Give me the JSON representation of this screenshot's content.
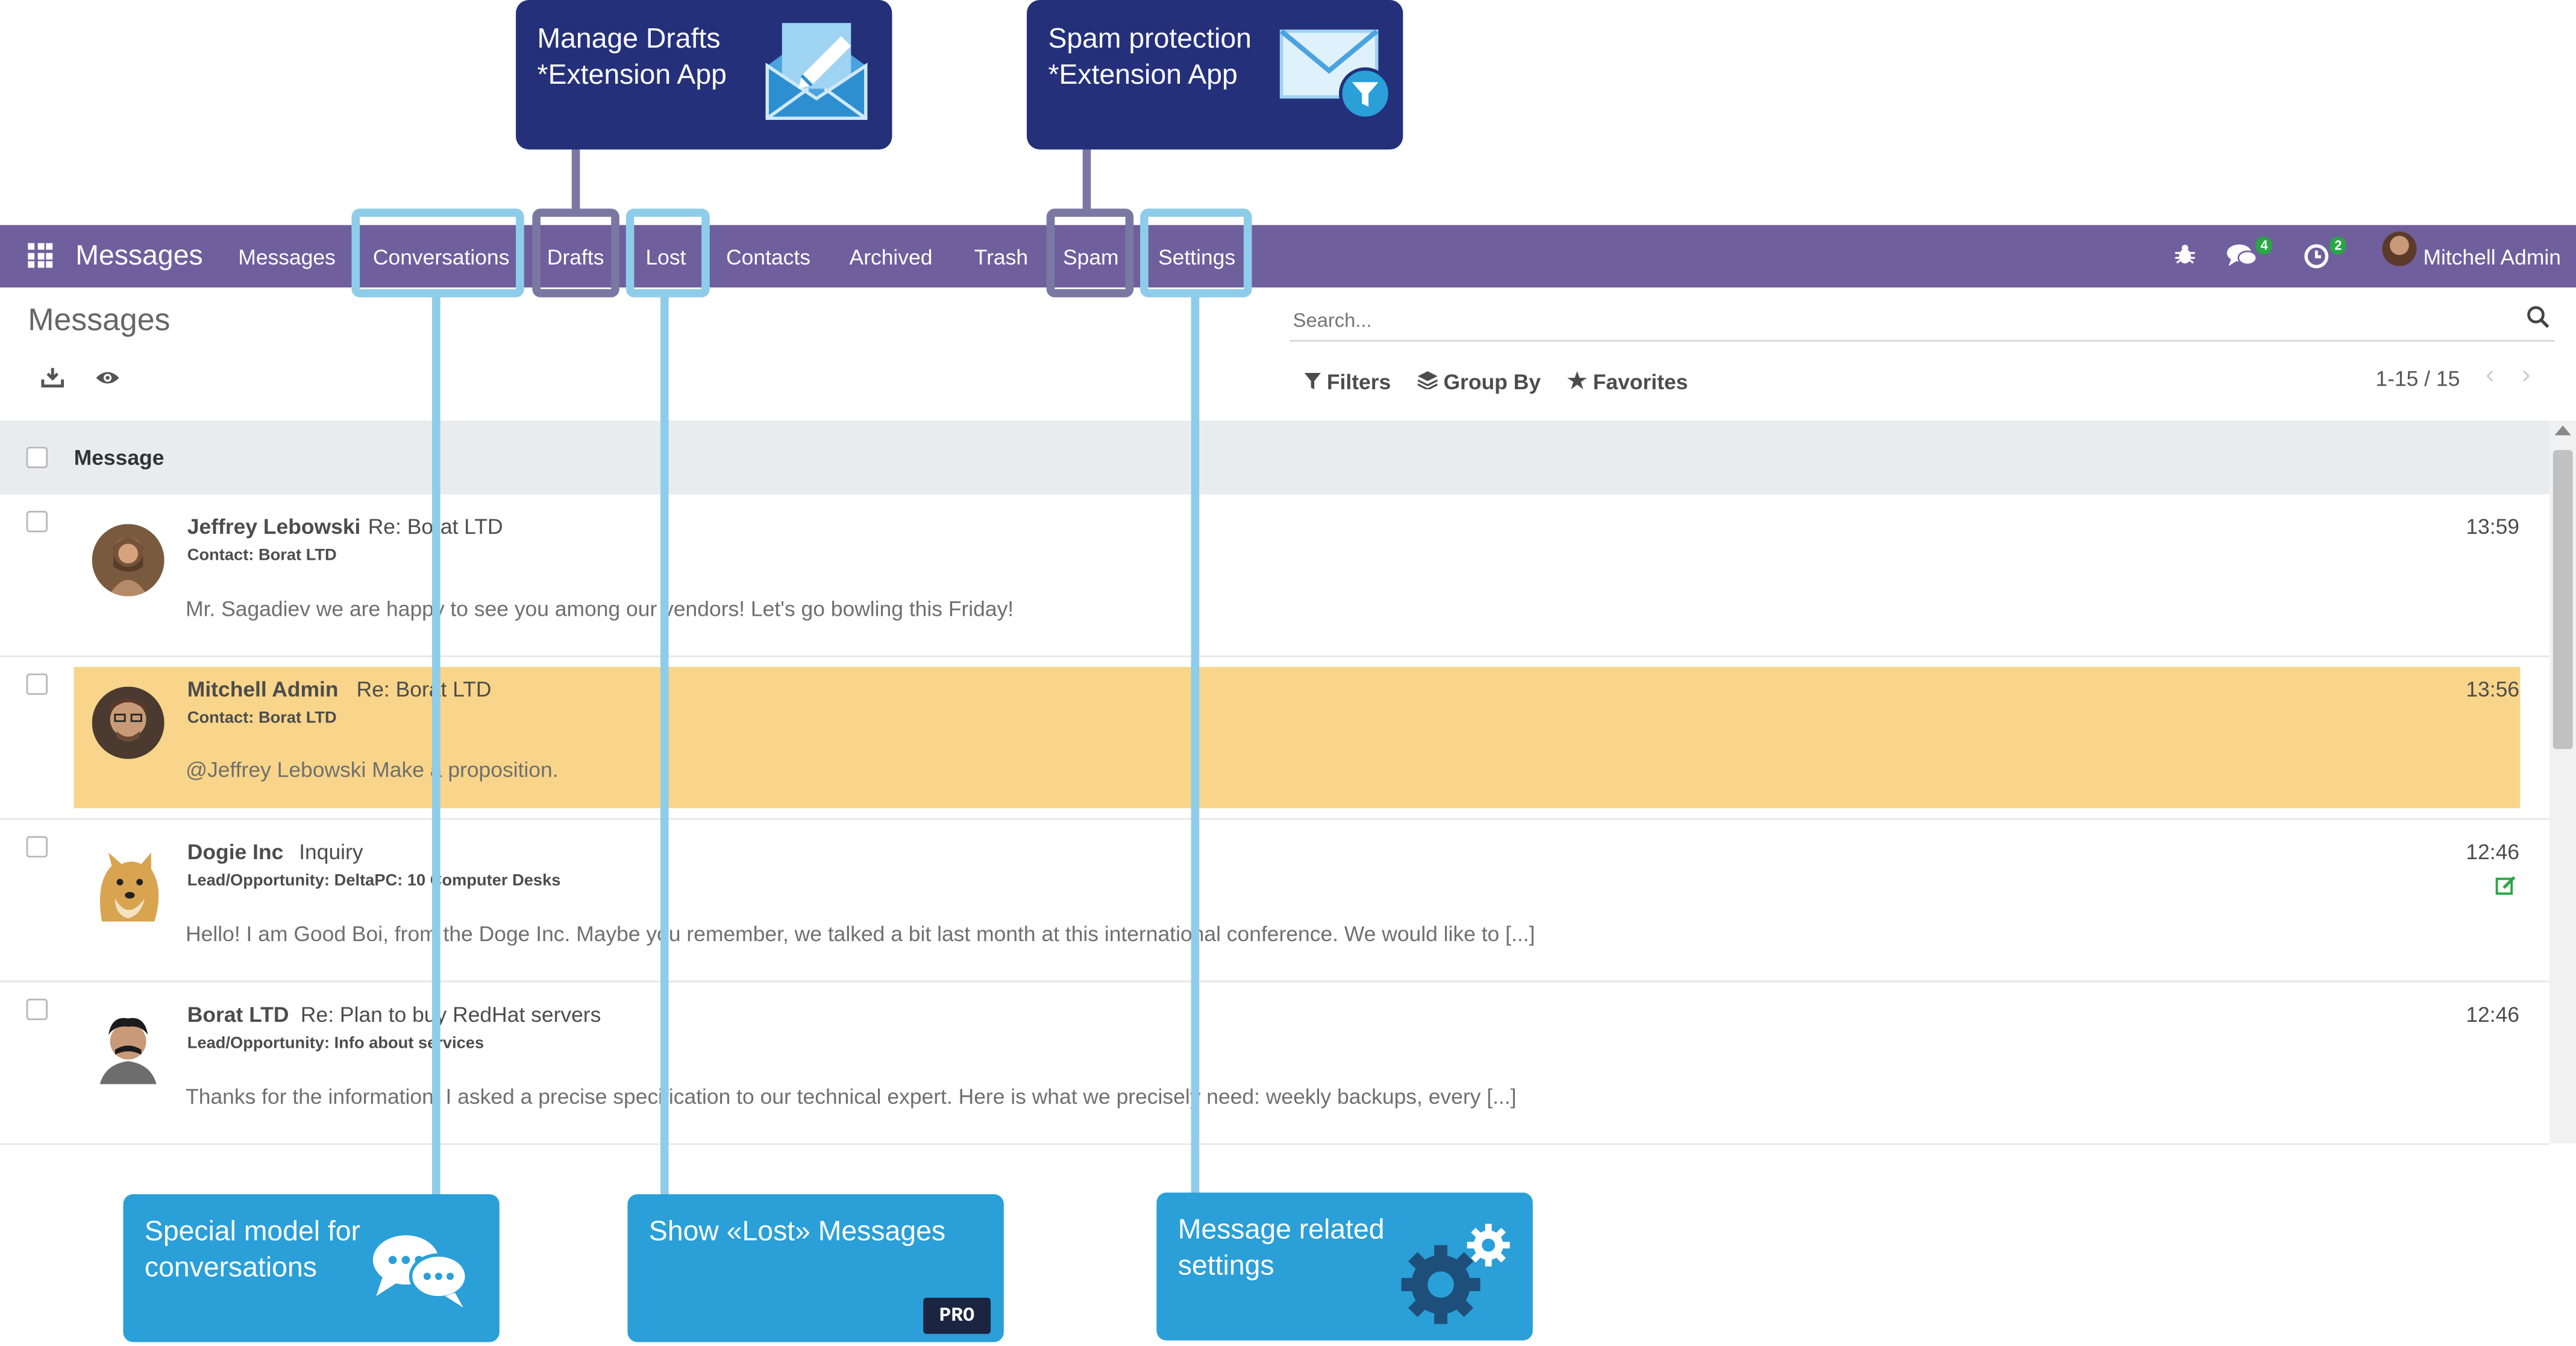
{
  "navbar": {
    "app_title": "Messages",
    "menu": [
      "Messages",
      "Conversations",
      "Drafts",
      "Lost",
      "Contacts",
      "Archived",
      "Trash",
      "Spam",
      "Settings"
    ],
    "chat_count": "4",
    "activity_count": "2",
    "user_name": "Mitchell Admin",
    "background_color": "#6f5f9c"
  },
  "control_panel": {
    "title": "Messages",
    "search_placeholder": "Search...",
    "filters_label": "Filters",
    "group_by_label": "Group By",
    "favorites_label": "Favorites",
    "pager": "1-15 / 15"
  },
  "list": {
    "column_header": "Message",
    "rows": [
      {
        "author": "Jeffrey Lebowski",
        "subject": "Re: Borat LTD",
        "reference": "Contact: Borat LTD",
        "body": "Mr. Sagadiev we are happy to see you among our vendors! Let's go bowling this Friday!",
        "time": "13:59",
        "highlighted": false
      },
      {
        "author": "Mitchell Admin",
        "subject": "Re: Borat LTD",
        "reference": "Contact: Borat LTD",
        "body": "@Jeffrey Lebowski Make a proposition.",
        "time": "13:56",
        "highlighted": true
      },
      {
        "author": "Dogie Inc",
        "subject": "Inquiry",
        "reference": "Lead/Opportunity: DeltaPC: 10 Computer Desks",
        "body": "Hello! I am Good Boi, from the Doge Inc. Maybe you remember, we talked a bit last month at this international conference. We would like to [...]",
        "time": "12:46",
        "highlighted": false
      },
      {
        "author": "Borat LTD",
        "subject": "Re: Plan to buy RedHat servers",
        "reference": "Lead/Opportunity: Info about services",
        "body": "Thanks for the information! I asked a precise specification to our technical expert. Here is what we precisely need: weekly backups, every [...]",
        "time": "12:46",
        "highlighted": false
      }
    ]
  },
  "callouts": {
    "drafts": "Manage Drafts\n*Extension App",
    "spam": "Spam protection\n*Extension App",
    "conversations": "Special model for\nconversations",
    "lost": "Show «Lost» Messages",
    "lost_badge": "PRO",
    "settings": "Message related\nsettings"
  },
  "colors": {
    "highlight_row": "#f8d58a",
    "callout_dark": "#24307a",
    "callout_light": "#2a9fd8",
    "annotation_line": "#8ecdea"
  }
}
